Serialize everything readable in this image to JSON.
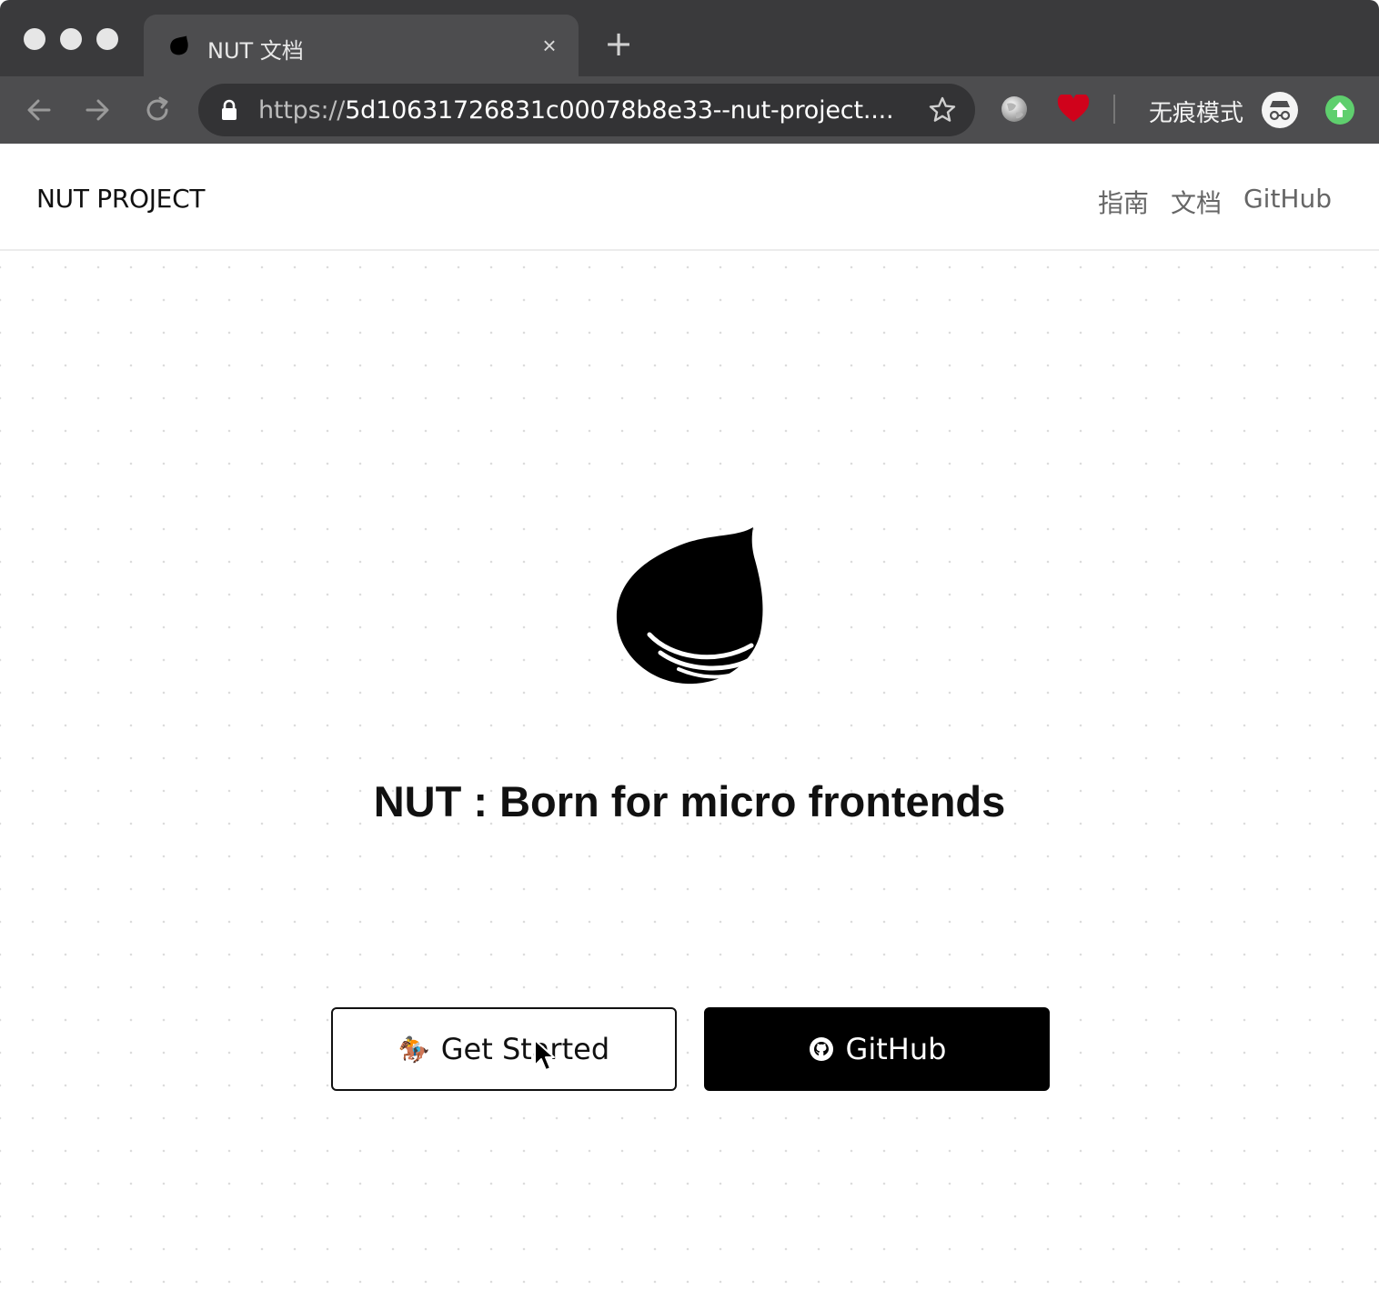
{
  "browser": {
    "tab": {
      "title": "NUT 文档",
      "close_glyph": "×"
    },
    "new_tab_glyph": "+",
    "address": {
      "scheme": "https://",
      "rest": "5d10631726831c00078b8e33--nut-project...."
    },
    "incognito_label": "无痕模式",
    "icons": {
      "back": "arrow-left-icon",
      "forward": "arrow-right-icon",
      "reload": "reload-icon",
      "lock": "lock-icon",
      "bookmark": "star-icon",
      "extension_1": "globe-icon",
      "extension_2": "heart-icon",
      "incognito": "incognito-icon",
      "update": "update-icon"
    },
    "colors": {
      "titlebar": "#3a3a3c",
      "toolbar": "#4d4d4f",
      "heart": "#d0021b",
      "update": "#5fcf6e"
    }
  },
  "site": {
    "brand": "NUT PROJECT",
    "nav": [
      {
        "label": "指南"
      },
      {
        "label": "文档"
      },
      {
        "label": "GitHub"
      }
    ],
    "hero": {
      "title": "NUT : Born for micro frontends",
      "logo": "nut-logo-icon"
    },
    "buttons": {
      "get_started": {
        "emoji": "🏇",
        "label": "Get Started"
      },
      "github": {
        "label": "GitHub",
        "icon": "github-icon"
      }
    }
  }
}
